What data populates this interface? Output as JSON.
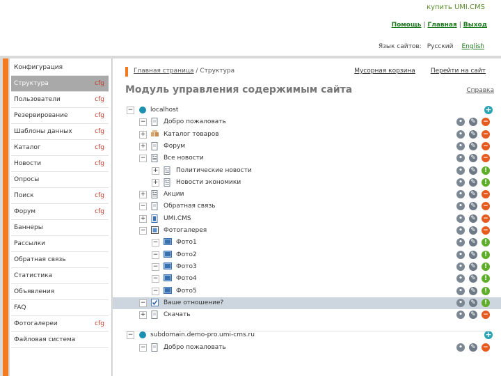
{
  "header": {
    "buy_link": "купить UMI.CMS",
    "help": "Помощь",
    "home": "Главная",
    "exit": "Выход",
    "sep": "|",
    "lang_label": "Язык сайтов:",
    "lang_current": "Русский",
    "lang_english": "English"
  },
  "sidebar": {
    "items": [
      {
        "label": "Конфигурация",
        "cfg": ""
      },
      {
        "label": "Структура",
        "cfg": "cfg"
      },
      {
        "label": "Пользователи",
        "cfg": "cfg"
      },
      {
        "label": "Резервирование",
        "cfg": "cfg"
      },
      {
        "label": "Шаблоны данных",
        "cfg": "cfg"
      },
      {
        "label": "Каталог",
        "cfg": "cfg"
      },
      {
        "label": "Новости",
        "cfg": "cfg"
      },
      {
        "label": "Опросы",
        "cfg": ""
      },
      {
        "label": "Поиск",
        "cfg": "cfg"
      },
      {
        "label": "Форум",
        "cfg": "cfg"
      },
      {
        "label": "Баннеры",
        "cfg": ""
      },
      {
        "label": "Рассылки",
        "cfg": ""
      },
      {
        "label": "Обратная связь",
        "cfg": ""
      },
      {
        "label": "Статистика",
        "cfg": ""
      },
      {
        "label": "Объявления",
        "cfg": ""
      },
      {
        "label": "FAQ",
        "cfg": ""
      },
      {
        "label": "Фотогалереи",
        "cfg": "cfg"
      },
      {
        "label": "Файловая система",
        "cfg": ""
      }
    ]
  },
  "main": {
    "crumb_home": "Главная страница",
    "crumb_sep": "/",
    "crumb_current": "Структура",
    "trash": "Мусорная корзина",
    "goto_site": "Перейти на сайт",
    "title": "Модуль управления содержимым сайта",
    "help": "Справка",
    "tree": [
      {
        "label": "localhost",
        "level": 0,
        "toggle": "−",
        "icon": "globe",
        "domain": true
      },
      {
        "label": "Добро пожаловать",
        "level": 1,
        "toggle": "−",
        "icon": "page",
        "status": "red"
      },
      {
        "label": "Каталог товаров",
        "level": 1,
        "toggle": "+",
        "icon": "catalog",
        "status": "red"
      },
      {
        "label": "Форум",
        "level": 1,
        "toggle": "+",
        "icon": "page",
        "status": "red"
      },
      {
        "label": "Все новости",
        "level": 1,
        "toggle": "−",
        "icon": "news",
        "status": "red"
      },
      {
        "label": "Политические новости",
        "level": 2,
        "toggle": "+",
        "icon": "news",
        "status": "green"
      },
      {
        "label": "Новости экономики",
        "level": 2,
        "toggle": "+",
        "icon": "news",
        "status": "green"
      },
      {
        "label": "Акции",
        "level": 1,
        "toggle": "+",
        "icon": "news",
        "status": "red"
      },
      {
        "label": "Обратная связь",
        "level": 1,
        "toggle": "−",
        "icon": "page",
        "status": "red"
      },
      {
        "label": "UMI.CMS",
        "level": 1,
        "toggle": "+",
        "icon": "umi",
        "status": "red"
      },
      {
        "label": "Фотогалерея",
        "level": 1,
        "toggle": "−",
        "icon": "gallery",
        "status": "red"
      },
      {
        "label": "Фото1",
        "level": 2,
        "toggle": "−",
        "icon": "photo",
        "status": "green"
      },
      {
        "label": "Фото2",
        "level": 2,
        "toggle": "−",
        "icon": "photo",
        "status": "green"
      },
      {
        "label": "Фото3",
        "level": 2,
        "toggle": "−",
        "icon": "photo",
        "status": "green"
      },
      {
        "label": "Фото4",
        "level": 2,
        "toggle": "−",
        "icon": "photo",
        "status": "green"
      },
      {
        "label": "Фото5",
        "level": 2,
        "toggle": "−",
        "icon": "photo",
        "status": "green"
      },
      {
        "label": "Ваше отношение?",
        "level": 1,
        "toggle": "−",
        "icon": "vote",
        "status": "green",
        "highlight": true
      },
      {
        "label": "Скачать",
        "level": 1,
        "toggle": "+",
        "icon": "page",
        "status": "red"
      },
      {
        "label": "subdomain.demo-pro.umi-cms.ru",
        "level": 0,
        "toggle": "−",
        "icon": "globe",
        "domain": true
      },
      {
        "label": "Добро пожаловать",
        "level": 1,
        "toggle": "−",
        "icon": "page",
        "status": "red"
      }
    ]
  },
  "colors": {
    "accent": "#f47a20",
    "link_green": "#1f7a1f",
    "cfg_red": "#c0392b",
    "status_red": "#e55a1f",
    "status_green": "#5fae2a",
    "add_teal": "#2aa4b3"
  }
}
